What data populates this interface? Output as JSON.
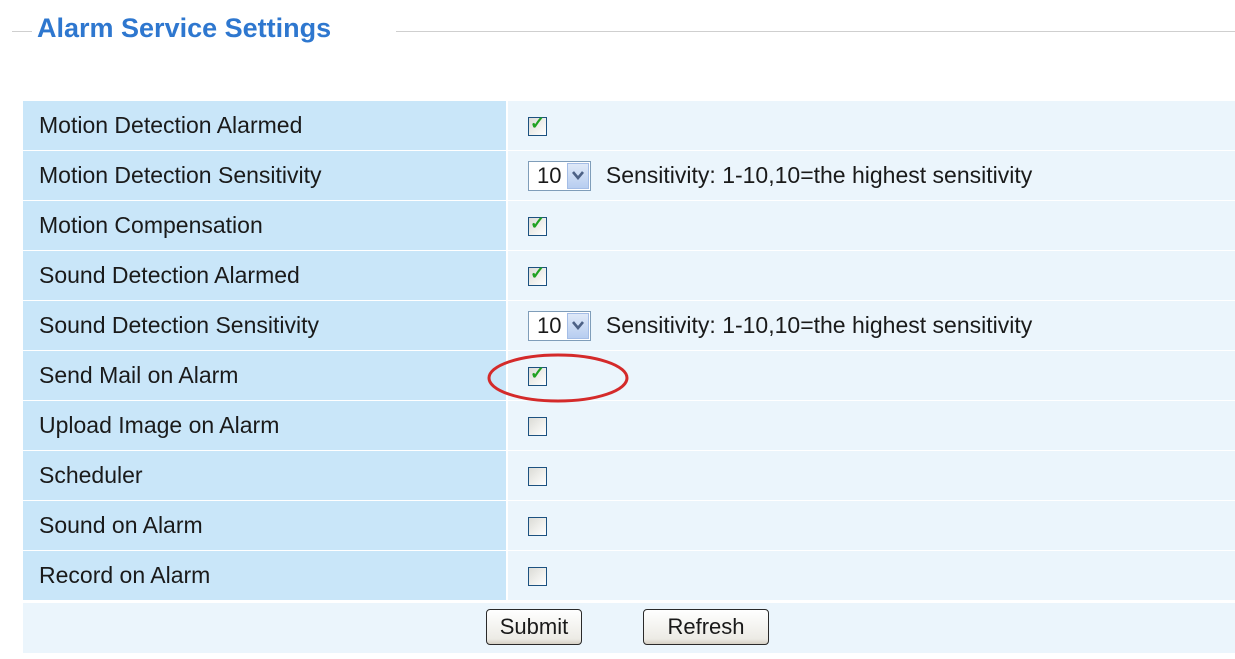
{
  "legend": {
    "title": "Alarm Service Settings"
  },
  "rows": [
    {
      "label": "Motion Detection Alarmed",
      "type": "checkbox",
      "checked": true
    },
    {
      "label": "Motion Detection Sensitivity",
      "type": "select",
      "value": "10",
      "help": "Sensitivity: 1-10,10=the highest sensitivity"
    },
    {
      "label": "Motion Compensation",
      "type": "checkbox",
      "checked": true
    },
    {
      "label": "Sound Detection Alarmed",
      "type": "checkbox",
      "checked": true
    },
    {
      "label": "Sound Detection Sensitivity",
      "type": "select",
      "value": "10",
      "help": "Sensitivity: 1-10,10=the highest sensitivity"
    },
    {
      "label": "Send Mail on Alarm",
      "type": "checkbox",
      "checked": true
    },
    {
      "label": "Upload Image on Alarm",
      "type": "checkbox",
      "checked": false
    },
    {
      "label": "Scheduler",
      "type": "checkbox",
      "checked": false
    },
    {
      "label": "Sound on Alarm",
      "type": "checkbox",
      "checked": false
    },
    {
      "label": "Record on Alarm",
      "type": "checkbox",
      "checked": false
    }
  ],
  "buttons": {
    "submit": "Submit",
    "refresh": "Refresh"
  },
  "icons": {
    "check": "check-icon",
    "dropdown": "chevron-down-icon",
    "annotation": "red-ellipse-highlight"
  },
  "colors": {
    "title": "#2e77cf",
    "label_bg": "#c9e6f9",
    "value_bg": "#ebf5fc",
    "check": "#21a121",
    "highlight": "#d42a2a"
  }
}
